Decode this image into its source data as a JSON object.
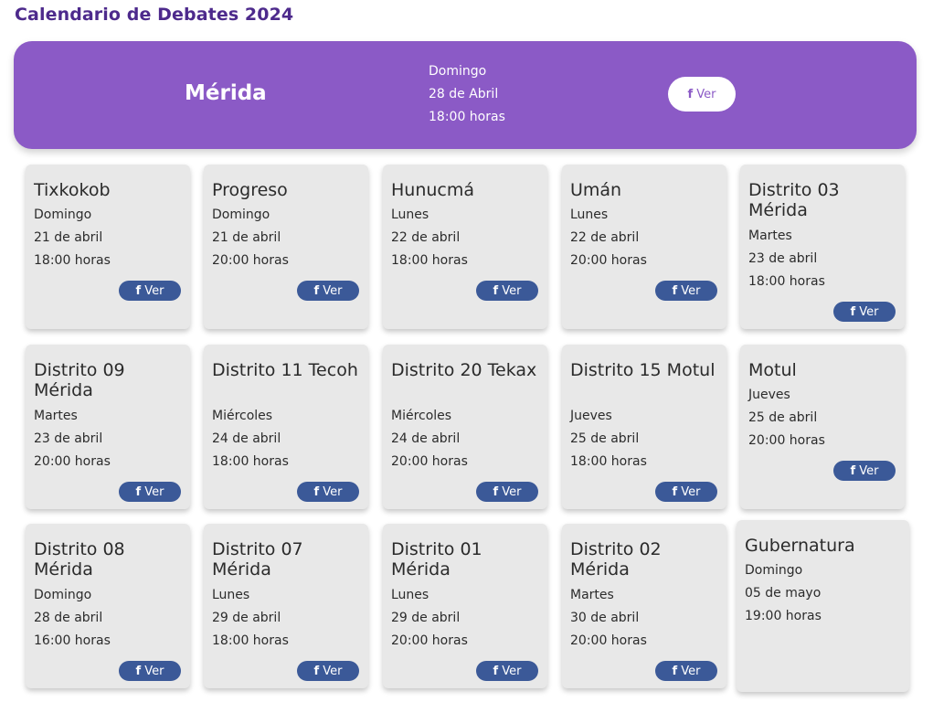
{
  "page_title": "Calendario de Debates 2024",
  "featured": {
    "city": "Mérida",
    "day": "Domingo",
    "date": "28 de Abril",
    "time": "18:00 horas",
    "button_label": "Ver",
    "button_icon": "facebook-icon"
  },
  "fb_icon_glyph": "f",
  "ver_label": "Ver",
  "events": [
    {
      "title": "Tixkokob",
      "day": "Domingo",
      "date": "21 de abril",
      "time": "18:00 horas"
    },
    {
      "title": "Progreso",
      "day": "Domingo",
      "date": "21 de abril",
      "time": "20:00 horas"
    },
    {
      "title": "Hunucmá",
      "day": "Lunes",
      "date": "22 de abril",
      "time": "18:00 horas"
    },
    {
      "title": "Umán",
      "day": "Lunes",
      "date": "22 de abril",
      "time": "20:00 horas"
    },
    {
      "title": "Distrito 03 Mérida",
      "day": "Martes",
      "date": "23 de abril",
      "time": "18:00 horas"
    },
    {
      "title": "Distrito 09 Mérida",
      "day": "Martes",
      "date": "23 de abril",
      "time": "20:00 horas"
    },
    {
      "title": "Distrito 11 Tecoh",
      "day": "Miércoles",
      "date": "24 de abril",
      "time": "18:00 horas"
    },
    {
      "title": "Distrito 20 Tekax",
      "day": "Miércoles",
      "date": "24 de abril",
      "time": "20:00 horas"
    },
    {
      "title": "Distrito 15 Motul",
      "day": "Jueves",
      "date": "25 de abril",
      "time": "18:00 horas"
    },
    {
      "title": "Motul",
      "day": "Jueves",
      "date": "25 de abril",
      "time": "20:00 horas"
    },
    {
      "title": "Distrito 08 Mérida",
      "day": "Domingo",
      "date": "28 de abril",
      "time": "16:00 horas"
    },
    {
      "title": "Distrito 07 Mérida",
      "day": "Lunes",
      "date": "29 de abril",
      "time": "18:00 horas"
    },
    {
      "title": "Distrito 01 Mérida",
      "day": "Lunes",
      "date": "29 de abril",
      "time": "20:00 horas"
    },
    {
      "title": "Distrito 02 Mérida",
      "day": "Martes",
      "date": "30 de abril",
      "time": "20:00 horas"
    },
    {
      "title": "Gubernatura",
      "day": "Domingo",
      "date": "05 de mayo",
      "time": "19:00 horas"
    }
  ],
  "colors": {
    "title": "#4d2a8c",
    "banner": "#8b5ac6",
    "card": "#e8e8e8",
    "facebook": "#3b5998"
  }
}
